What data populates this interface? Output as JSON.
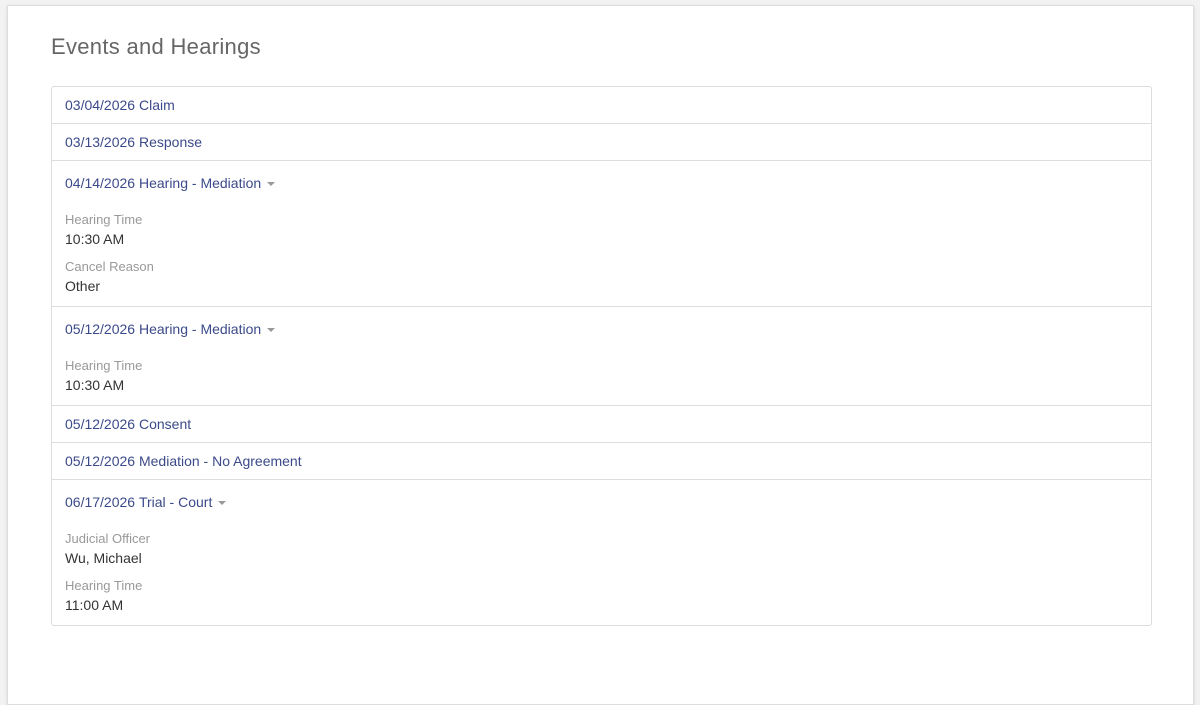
{
  "page": {
    "title": "Events and Hearings"
  },
  "events": [
    {
      "date": "03/04/2026",
      "title": "Claim",
      "expandable": false,
      "details": []
    },
    {
      "date": "03/13/2026",
      "title": "Response",
      "expandable": false,
      "details": []
    },
    {
      "date": "04/14/2026",
      "title": "Hearing - Mediation",
      "expandable": true,
      "details": [
        {
          "label": "Hearing Time",
          "value": "10:30 AM"
        },
        {
          "label": "Cancel Reason",
          "value": "Other"
        }
      ]
    },
    {
      "date": "05/12/2026",
      "title": "Hearing - Mediation",
      "expandable": true,
      "details": [
        {
          "label": "Hearing Time",
          "value": "10:30 AM"
        }
      ]
    },
    {
      "date": "05/12/2026",
      "title": "Consent",
      "expandable": false,
      "details": []
    },
    {
      "date": "05/12/2026",
      "title": "Mediation - No Agreement",
      "expandable": false,
      "details": []
    },
    {
      "date": "06/17/2026",
      "title": "Trial - Court",
      "expandable": true,
      "details": [
        {
          "label": "Judicial Officer",
          "value": "Wu, Michael"
        },
        {
          "label": "Hearing Time",
          "value": "11:00 AM"
        }
      ]
    }
  ],
  "icons": {
    "expand": "caret-down-icon"
  },
  "colors": {
    "link": "#3b4a8a",
    "label": "#999999",
    "value": "#333333",
    "border": "#dddddd"
  }
}
